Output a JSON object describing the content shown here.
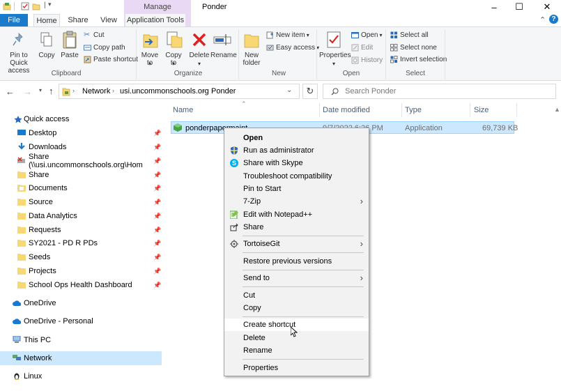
{
  "window": {
    "title": "Ponder",
    "context_tab_group": "Manage",
    "minimize": "–",
    "maximize": "☐",
    "close": "✕"
  },
  "tabs": [
    {
      "label": "File"
    },
    {
      "label": "Home"
    },
    {
      "label": "Share"
    },
    {
      "label": "View"
    },
    {
      "label": "Application Tools"
    }
  ],
  "ribbon": {
    "clipboard": {
      "pin": "Pin to Quick access",
      "copy": "Copy",
      "paste": "Paste",
      "cut": "Cut",
      "copy_path": "Copy path",
      "paste_shortcut": "Paste shortcut",
      "group": "Clipboard"
    },
    "organize": {
      "move_to": "Move to",
      "copy_to": "Copy to",
      "delete": "Delete",
      "rename": "Rename",
      "group": "Organize"
    },
    "new": {
      "new_folder": "New folder",
      "new_item": "New item",
      "easy_access": "Easy access",
      "group": "New"
    },
    "open": {
      "properties": "Properties",
      "open": "Open",
      "edit": "Edit",
      "history": "History",
      "group": "Open"
    },
    "select": {
      "select_all": "Select all",
      "select_none": "Select none",
      "invert": "Invert selection",
      "group": "Select"
    }
  },
  "address": {
    "crumbs": [
      "Network",
      "usi.uncommonschools.org",
      "Ponder"
    ],
    "search_placeholder": "Search Ponder"
  },
  "nav": {
    "quick_access": "Quick access",
    "items": [
      {
        "label": "Desktop"
      },
      {
        "label": "Downloads"
      },
      {
        "label": "Share (\\\\usi.uncommonschools.org\\Hom"
      },
      {
        "label": "Share"
      },
      {
        "label": "Documents"
      },
      {
        "label": "Source"
      },
      {
        "label": "Data Analytics"
      },
      {
        "label": "Requests"
      },
      {
        "label": "SY2021 - PD R PDs"
      },
      {
        "label": "Seeds"
      },
      {
        "label": "Projects"
      },
      {
        "label": "School Ops Health Dashboard"
      }
    ],
    "onedrive": "OneDrive",
    "onedrive_personal": "OneDrive - Personal",
    "this_pc": "This PC",
    "network": "Network",
    "linux": "Linux"
  },
  "columns": {
    "name": "Name",
    "date": "Date modified",
    "type": "Type",
    "size": "Size"
  },
  "file": {
    "name": "ponderpapermaint",
    "date": "9/7/2022 6:26 PM",
    "type": "Application",
    "size": "69,739 KB"
  },
  "context_menu": {
    "items": [
      {
        "label": "Open"
      },
      {
        "label": "Run as administrator"
      },
      {
        "label": "Share with Skype"
      },
      {
        "label": "Troubleshoot compatibility"
      },
      {
        "label": "Pin to Start"
      },
      {
        "label": "7-Zip"
      },
      {
        "label": "Edit with Notepad++"
      },
      {
        "label": "Share"
      },
      {
        "label": "TortoiseGit"
      },
      {
        "label": "Restore previous versions"
      },
      {
        "label": "Send to"
      },
      {
        "label": "Cut"
      },
      {
        "label": "Copy"
      },
      {
        "label": "Create shortcut"
      },
      {
        "label": "Delete"
      },
      {
        "label": "Rename"
      },
      {
        "label": "Properties"
      }
    ]
  },
  "colors": {
    "accent": "#1979ca",
    "selection": "#cce8ff",
    "folder": "#f8d775",
    "context_tab": "#e9d9f4"
  }
}
